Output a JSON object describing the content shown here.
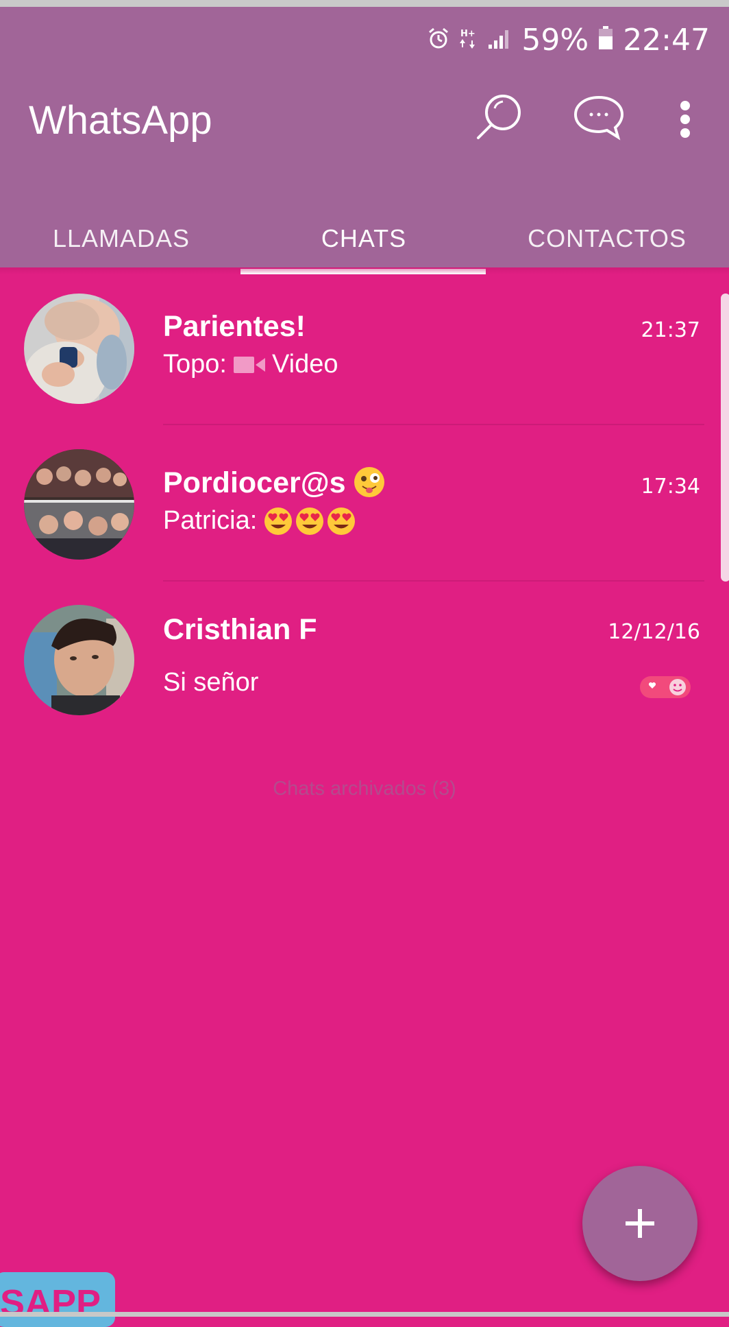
{
  "status_bar": {
    "icons": [
      "alarm-icon",
      "data-arrows-icon",
      "signal-icon",
      "battery-icon"
    ],
    "data_label": "H+",
    "battery_percent": "59%",
    "time": "22:47"
  },
  "app_bar": {
    "title": "WhatsApp",
    "icons": [
      "search-icon",
      "new-chat-icon",
      "more-vert-icon"
    ]
  },
  "tabs": [
    {
      "label": "LLAMADAS",
      "selected": false
    },
    {
      "label": "CHATS",
      "selected": true
    },
    {
      "label": "CONTACTOS",
      "selected": false
    }
  ],
  "chats": [
    {
      "name": "Parientes!",
      "time": "21:37",
      "sender": "Topo:",
      "message": "Video",
      "message_icon": "video-camera-icon",
      "avatar": "baby-photo"
    },
    {
      "name": "Pordiocer@s",
      "name_emoji": "zany-face-emoji",
      "time": "17:34",
      "sender": "Patricia:",
      "message_emojis": [
        "heart-eyes-emoji",
        "heart-eyes-emoji",
        "heart-eyes-emoji"
      ],
      "avatar": "group-photo"
    },
    {
      "name": "Cristhian F",
      "time": "12/12/16",
      "message": "Si señor",
      "badge_icon": "heart-smile-badge-icon",
      "avatar": "man-photo"
    }
  ],
  "archived_label": "Chats archivados (3)",
  "fab": {
    "icon": "plus-icon"
  },
  "watermark_text": "SAPP",
  "colors": {
    "background": "#e01f83",
    "app_bar": "#a16598",
    "text": "#ffffff",
    "archived_text": "#b44b8d",
    "watermark": "#63b6de"
  }
}
